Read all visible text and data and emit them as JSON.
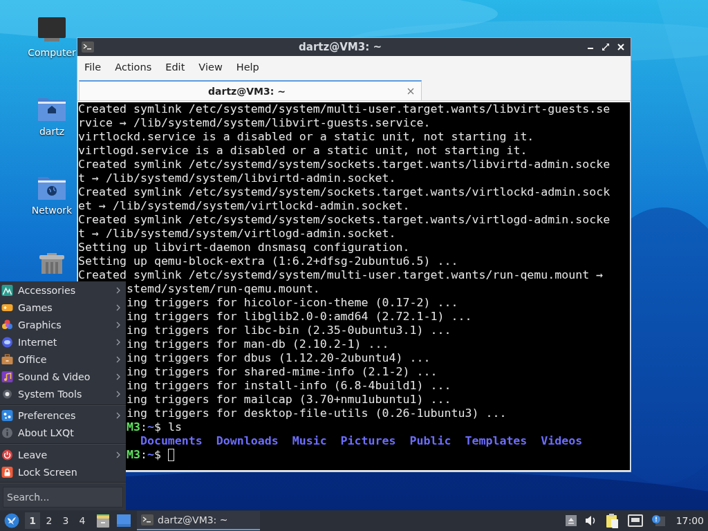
{
  "desktop_icons": [
    {
      "label": "Computer",
      "kind": "computer"
    },
    {
      "label": "dartz",
      "kind": "home"
    },
    {
      "label": "Network",
      "kind": "network"
    },
    {
      "kind": "trash"
    }
  ],
  "window": {
    "title": "dartz@VM3: ~",
    "menu": [
      "File",
      "Actions",
      "Edit",
      "View",
      "Help"
    ],
    "tabs": [
      {
        "label": "dartz@VM3: ~",
        "selected": true
      }
    ],
    "lines": [
      {
        "kind": "text",
        "text": "Created symlink /etc/systemd/system/multi-user.target.wants/libvirt-guests.se"
      },
      {
        "kind": "text",
        "text": "rvice → /lib/systemd/system/libvirt-guests.service."
      },
      {
        "kind": "text",
        "text": "virtlockd.service is a disabled or a static unit, not starting it."
      },
      {
        "kind": "text",
        "text": "virtlogd.service is a disabled or a static unit, not starting it."
      },
      {
        "kind": "text",
        "text": "Created symlink /etc/systemd/system/sockets.target.wants/libvirtd-admin.socke"
      },
      {
        "kind": "text",
        "text": "t → /lib/systemd/system/libvirtd-admin.socket."
      },
      {
        "kind": "text",
        "text": "Created symlink /etc/systemd/system/sockets.target.wants/virtlockd-admin.sock"
      },
      {
        "kind": "text",
        "text": "et → /lib/systemd/system/virtlockd-admin.socket."
      },
      {
        "kind": "text",
        "text": "Created symlink /etc/systemd/system/sockets.target.wants/virtlogd-admin.socke"
      },
      {
        "kind": "text",
        "text": "t → /lib/systemd/system/virtlogd-admin.socket."
      },
      {
        "kind": "text",
        "text": "Setting up libvirt-daemon dnsmasq configuration."
      },
      {
        "kind": "text",
        "text": "Setting up qemu-block-extra (1:6.2+dfsg-2ubuntu6.5) ..."
      },
      {
        "kind": "text",
        "text": "Created symlink /etc/systemd/system/multi-user.target.wants/run-qemu.mount →"
      },
      {
        "kind": "partial",
        "text": "stemd/system/run-qemu.mount."
      },
      {
        "kind": "partial",
        "text": "ing triggers for hicolor-icon-theme (0.17-2) ..."
      },
      {
        "kind": "partial",
        "text": "ing triggers for libglib2.0-0:amd64 (2.72.1-1) ..."
      },
      {
        "kind": "partial",
        "text": "ing triggers for libc-bin (2.35-0ubuntu3.1) ..."
      },
      {
        "kind": "partial",
        "text": "ing triggers for man-db (2.10.2-1) ..."
      },
      {
        "kind": "partial",
        "text": "ing triggers for dbus (1.12.20-2ubuntu4) ..."
      },
      {
        "kind": "partial",
        "text": "ing triggers for shared-mime-info (2.1-2) ..."
      },
      {
        "kind": "partial",
        "text": "ing triggers for install-info (6.8-4build1) ..."
      },
      {
        "kind": "partial",
        "text": "ing triggers for mailcap (3.70+nmu1ubuntu1) ..."
      },
      {
        "kind": "partial",
        "text": "ing triggers for desktop-file-utils (0.26-1ubuntu3) ..."
      },
      {
        "kind": "prompt",
        "segments": [
          {
            "kind": "host",
            "text": "M3"
          },
          {
            "kind": "plain",
            "text": ":"
          },
          {
            "kind": "path",
            "text": "~"
          },
          {
            "kind": "plain",
            "text": "$ ls"
          }
        ],
        "cursor": false
      },
      {
        "kind": "listing",
        "items": [
          "Documents",
          "Downloads",
          "Music",
          "Pictures",
          "Public",
          "Templates",
          "Videos"
        ]
      },
      {
        "kind": "prompt",
        "segments": [
          {
            "kind": "host",
            "text": "M3"
          },
          {
            "kind": "plain",
            "text": ":"
          },
          {
            "kind": "path",
            "text": "~"
          },
          {
            "kind": "plain",
            "text": "$"
          }
        ],
        "cursor": true
      }
    ]
  },
  "start_menu": {
    "groups": [
      [
        {
          "label": "Accessories",
          "kind": "accessories",
          "submenu": true
        },
        {
          "label": "Games",
          "kind": "games",
          "submenu": true
        },
        {
          "label": "Graphics",
          "kind": "graphics",
          "submenu": true
        },
        {
          "label": "Internet",
          "kind": "internet",
          "submenu": true
        },
        {
          "label": "Office",
          "kind": "office",
          "submenu": true
        },
        {
          "label": "Sound & Video",
          "kind": "media",
          "submenu": true
        },
        {
          "label": "System Tools",
          "kind": "tools",
          "submenu": true
        }
      ],
      [
        {
          "label": "Preferences",
          "kind": "preferences",
          "submenu": true
        },
        {
          "label": "About LXQt",
          "kind": "about",
          "submenu": false
        }
      ],
      [
        {
          "label": "Leave",
          "kind": "leave",
          "submenu": true
        },
        {
          "label": "Lock Screen",
          "kind": "lock",
          "submenu": false
        }
      ]
    ],
    "search": {
      "placeholder": "Search..."
    }
  },
  "taskbar": {
    "desktops": [
      {
        "label": "1",
        "selected": true
      },
      {
        "label": "2",
        "selected": false
      },
      {
        "label": "3",
        "selected": false
      },
      {
        "label": "4",
        "selected": false
      }
    ],
    "tasks": [
      {
        "label": "dartz@VM3: ~",
        "selected": true
      }
    ],
    "clock": "17:00"
  }
}
